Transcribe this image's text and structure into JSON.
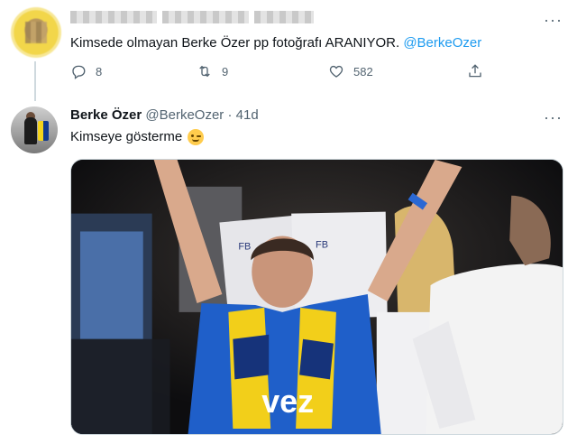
{
  "tweet1": {
    "text": "Kimsede olmayan Berke Özer pp fotoğrafı ARANIYOR.",
    "mention": "@BerkeOzer",
    "more": "···",
    "replies": "8",
    "retweets": "9",
    "likes": "582",
    "icons": {
      "reply": "reply-icon",
      "retweet": "retweet-icon",
      "like": "heart-icon",
      "share": "share-icon"
    }
  },
  "tweet2": {
    "display_name": "Berke Özer",
    "handle": "@BerkeOzer",
    "separator": "·",
    "time": "41d",
    "text": "Kimseye gösterme",
    "emoji": "winking-face-icon",
    "more": "···"
  },
  "media": {
    "jersey_text": "vez",
    "shirt_label_left": "FB",
    "shirt_label_right": "FB"
  },
  "colors": {
    "accent": "#1d9bf0",
    "muted": "#536471",
    "jersey_blue": "#1f5fc9",
    "scarf_yellow": "#f2cf1a"
  }
}
